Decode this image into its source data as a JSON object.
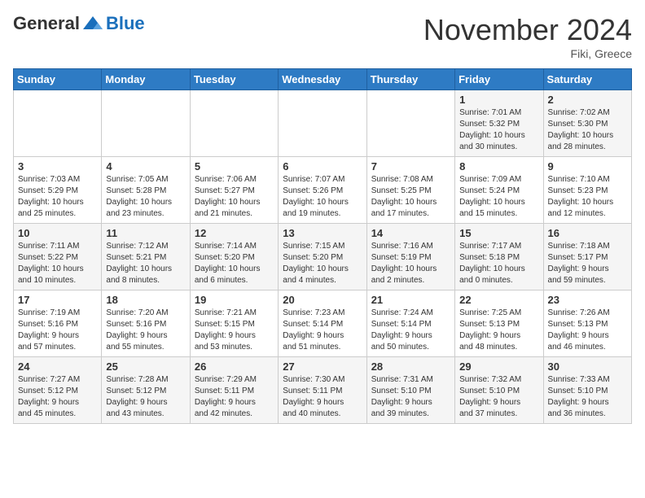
{
  "header": {
    "logo_general": "General",
    "logo_blue": "Blue",
    "month_title": "November 2024",
    "location": "Fiki, Greece"
  },
  "weekdays": [
    "Sunday",
    "Monday",
    "Tuesday",
    "Wednesday",
    "Thursday",
    "Friday",
    "Saturday"
  ],
  "weeks": [
    [
      {
        "day": "",
        "info": ""
      },
      {
        "day": "",
        "info": ""
      },
      {
        "day": "",
        "info": ""
      },
      {
        "day": "",
        "info": ""
      },
      {
        "day": "",
        "info": ""
      },
      {
        "day": "1",
        "info": "Sunrise: 7:01 AM\nSunset: 5:32 PM\nDaylight: 10 hours\nand 30 minutes."
      },
      {
        "day": "2",
        "info": "Sunrise: 7:02 AM\nSunset: 5:30 PM\nDaylight: 10 hours\nand 28 minutes."
      }
    ],
    [
      {
        "day": "3",
        "info": "Sunrise: 7:03 AM\nSunset: 5:29 PM\nDaylight: 10 hours\nand 25 minutes."
      },
      {
        "day": "4",
        "info": "Sunrise: 7:05 AM\nSunset: 5:28 PM\nDaylight: 10 hours\nand 23 minutes."
      },
      {
        "day": "5",
        "info": "Sunrise: 7:06 AM\nSunset: 5:27 PM\nDaylight: 10 hours\nand 21 minutes."
      },
      {
        "day": "6",
        "info": "Sunrise: 7:07 AM\nSunset: 5:26 PM\nDaylight: 10 hours\nand 19 minutes."
      },
      {
        "day": "7",
        "info": "Sunrise: 7:08 AM\nSunset: 5:25 PM\nDaylight: 10 hours\nand 17 minutes."
      },
      {
        "day": "8",
        "info": "Sunrise: 7:09 AM\nSunset: 5:24 PM\nDaylight: 10 hours\nand 15 minutes."
      },
      {
        "day": "9",
        "info": "Sunrise: 7:10 AM\nSunset: 5:23 PM\nDaylight: 10 hours\nand 12 minutes."
      }
    ],
    [
      {
        "day": "10",
        "info": "Sunrise: 7:11 AM\nSunset: 5:22 PM\nDaylight: 10 hours\nand 10 minutes."
      },
      {
        "day": "11",
        "info": "Sunrise: 7:12 AM\nSunset: 5:21 PM\nDaylight: 10 hours\nand 8 minutes."
      },
      {
        "day": "12",
        "info": "Sunrise: 7:14 AM\nSunset: 5:20 PM\nDaylight: 10 hours\nand 6 minutes."
      },
      {
        "day": "13",
        "info": "Sunrise: 7:15 AM\nSunset: 5:20 PM\nDaylight: 10 hours\nand 4 minutes."
      },
      {
        "day": "14",
        "info": "Sunrise: 7:16 AM\nSunset: 5:19 PM\nDaylight: 10 hours\nand 2 minutes."
      },
      {
        "day": "15",
        "info": "Sunrise: 7:17 AM\nSunset: 5:18 PM\nDaylight: 10 hours\nand 0 minutes."
      },
      {
        "day": "16",
        "info": "Sunrise: 7:18 AM\nSunset: 5:17 PM\nDaylight: 9 hours\nand 59 minutes."
      }
    ],
    [
      {
        "day": "17",
        "info": "Sunrise: 7:19 AM\nSunset: 5:16 PM\nDaylight: 9 hours\nand 57 minutes."
      },
      {
        "day": "18",
        "info": "Sunrise: 7:20 AM\nSunset: 5:16 PM\nDaylight: 9 hours\nand 55 minutes."
      },
      {
        "day": "19",
        "info": "Sunrise: 7:21 AM\nSunset: 5:15 PM\nDaylight: 9 hours\nand 53 minutes."
      },
      {
        "day": "20",
        "info": "Sunrise: 7:23 AM\nSunset: 5:14 PM\nDaylight: 9 hours\nand 51 minutes."
      },
      {
        "day": "21",
        "info": "Sunrise: 7:24 AM\nSunset: 5:14 PM\nDaylight: 9 hours\nand 50 minutes."
      },
      {
        "day": "22",
        "info": "Sunrise: 7:25 AM\nSunset: 5:13 PM\nDaylight: 9 hours\nand 48 minutes."
      },
      {
        "day": "23",
        "info": "Sunrise: 7:26 AM\nSunset: 5:13 PM\nDaylight: 9 hours\nand 46 minutes."
      }
    ],
    [
      {
        "day": "24",
        "info": "Sunrise: 7:27 AM\nSunset: 5:12 PM\nDaylight: 9 hours\nand 45 minutes."
      },
      {
        "day": "25",
        "info": "Sunrise: 7:28 AM\nSunset: 5:12 PM\nDaylight: 9 hours\nand 43 minutes."
      },
      {
        "day": "26",
        "info": "Sunrise: 7:29 AM\nSunset: 5:11 PM\nDaylight: 9 hours\nand 42 minutes."
      },
      {
        "day": "27",
        "info": "Sunrise: 7:30 AM\nSunset: 5:11 PM\nDaylight: 9 hours\nand 40 minutes."
      },
      {
        "day": "28",
        "info": "Sunrise: 7:31 AM\nSunset: 5:10 PM\nDaylight: 9 hours\nand 39 minutes."
      },
      {
        "day": "29",
        "info": "Sunrise: 7:32 AM\nSunset: 5:10 PM\nDaylight: 9 hours\nand 37 minutes."
      },
      {
        "day": "30",
        "info": "Sunrise: 7:33 AM\nSunset: 5:10 PM\nDaylight: 9 hours\nand 36 minutes."
      }
    ]
  ]
}
